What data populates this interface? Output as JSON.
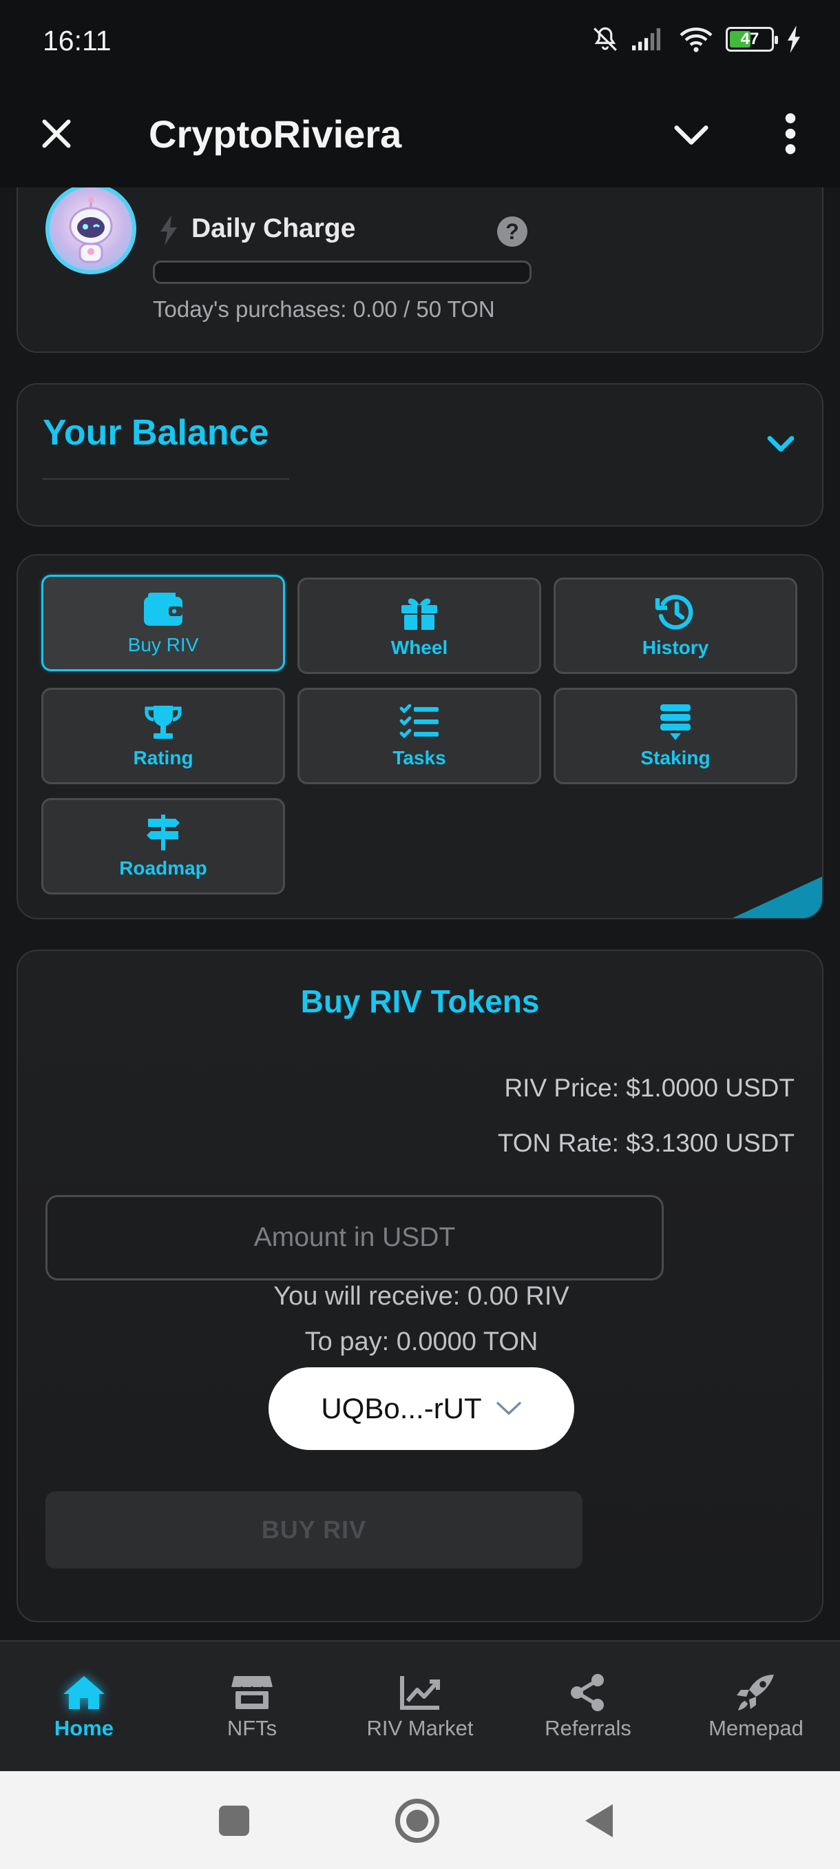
{
  "status_bar": {
    "time": "16:11",
    "battery": "47",
    "icons": [
      "mute-bell-icon",
      "signal-icon",
      "wifi-icon",
      "battery-icon",
      "charging-bolt-icon"
    ]
  },
  "app_bar": {
    "title": "CryptoRiviera",
    "icons": [
      "close-icon",
      "chevron-down-icon",
      "more-vertical-icon"
    ]
  },
  "daily_charge": {
    "title": "Daily Charge",
    "progress": 0,
    "subtitle": "Today's purchases: 0.00 / 50 TON",
    "help": "?"
  },
  "balance": {
    "title": "Your Balance"
  },
  "actions": [
    {
      "label": "Buy RIV",
      "icon": "wallet-icon",
      "active": true
    },
    {
      "label": "Wheel",
      "icon": "gift-icon",
      "active": false
    },
    {
      "label": "History",
      "icon": "history-icon",
      "active": false
    },
    {
      "label": "Rating",
      "icon": "trophy-icon",
      "active": false
    },
    {
      "label": "Tasks",
      "icon": "tasks-list-icon",
      "active": false
    },
    {
      "label": "Staking",
      "icon": "staking-layers-icon",
      "active": false
    },
    {
      "label": "Roadmap",
      "icon": "signpost-icon",
      "active": false
    }
  ],
  "buy": {
    "title": "Buy RIV Tokens",
    "price": "RIV Price: $1.0000 USDT",
    "rate": "TON Rate: $3.1300 USDT",
    "amount_placeholder": "Amount in USDT",
    "amount_value": "",
    "receive": "You will receive: 0.00 RIV",
    "pay": "To pay: 0.0000 TON",
    "wallet": "UQBo...-rUT",
    "button": "BUY RIV"
  },
  "bottom_nav": [
    {
      "label": "Home",
      "icon": "home-icon",
      "active": true
    },
    {
      "label": "NFTs",
      "icon": "store-icon",
      "active": false
    },
    {
      "label": "RIV Market",
      "icon": "chart-line-icon",
      "active": false
    },
    {
      "label": "Referrals",
      "icon": "share-icon",
      "active": false
    },
    {
      "label": "Memepad",
      "icon": "rocket-icon",
      "active": false
    }
  ],
  "colors": {
    "accent": "#17c7f1",
    "background": "#161718",
    "card": "#1e1f21",
    "tile": "#303133"
  }
}
